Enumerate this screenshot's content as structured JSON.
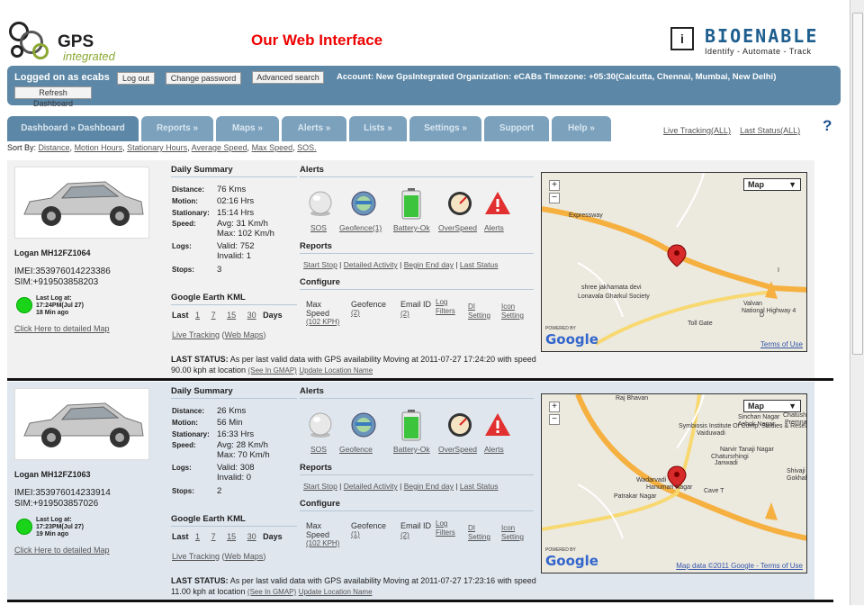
{
  "header": {
    "logo_gps": "GPS",
    "logo_integrated": "integrated",
    "page_heading": "Our Web Interface",
    "brand_name": "BIOENABLE",
    "brand_tagline": "Identify - Automate - Track"
  },
  "userbar": {
    "logged_on": "Logged on as ecabs",
    "logout": "Log out",
    "change_password": "Change password",
    "advanced_search": "Advanced search",
    "refresh": "Refresh Dashboard",
    "account_info": "Account: New GpsIntegrated Organization: eCABs  Timezone: +05:30(Calcutta, Chennai, Mumbai, New Delhi)"
  },
  "tabs": [
    {
      "label": "Dashboard » Dashboard"
    },
    {
      "label": "Reports »"
    },
    {
      "label": "Maps »"
    },
    {
      "label": "Alerts »"
    },
    {
      "label": "Lists »"
    },
    {
      "label": "Settings »"
    },
    {
      "label": "Support"
    },
    {
      "label": "Help »"
    }
  ],
  "right_links": {
    "live_all": "Live Tracking(ALL)",
    "last_all": "Last Status(ALL)",
    "help": "?"
  },
  "sort": {
    "label": "Sort By:",
    "options": [
      "Distance",
      "Motion Hours",
      "Stationary Hours",
      "Average Speed",
      "Max Speed",
      "SOS."
    ]
  },
  "sections": {
    "daily_summary": "Daily Summary",
    "alerts": "Alerts",
    "reports": "Reports",
    "configure": "Configure",
    "kml": "Google Earth KML",
    "kml_last": "Last",
    "kml_days": "Days",
    "kml_options": [
      "1",
      "7",
      "15",
      "30"
    ],
    "live_tracking": "Live Tracking",
    "web_maps": "Web Maps",
    "detail_map": "Click Here to detailed Map",
    "report_links": [
      "Start Stop",
      "Detailed Activity",
      "Begin End day",
      "Last Status"
    ],
    "cfg_maxspeed": "Max Speed",
    "cfg_geofence": "Geofence",
    "cfg_email": "Email ID",
    "cfg_log": "Log Filters",
    "cfg_di": "DI Setting",
    "cfg_icon": "Icon Setting",
    "last_status_label": "LAST STATUS:",
    "see_gmap": "(See In GMAP)",
    "update_loc": "Update Location Name"
  },
  "labels": {
    "distance": "Distance:",
    "motion": "Motion:",
    "stationary": "Stationary:",
    "speed": "Speed:",
    "logs": "Logs:",
    "stops": "Stops:"
  },
  "vehicles": [
    {
      "name": "Logan MH12FZ1064",
      "imei": "IMEI:353976014223386",
      "sim": "SIM:+919503858203",
      "lastlog_head": "Last Log at:",
      "lastlog_time": "17:24PM(Jul 27)",
      "lastlog_ago": "18 Min ago",
      "distance": "76 Kms",
      "motion": "02:16 Hrs",
      "stationary": "15:14 Hrs",
      "speed_avg": "Avg: 31 Km/h",
      "speed_max": "Max: 102 Km/h",
      "logs_valid": "Valid: 752",
      "logs_invalid": "Invalid: 1",
      "stops": "3",
      "alerts": [
        "SOS",
        "Geofence(1)",
        "Battery-Ok",
        "OverSpeed",
        "Alerts"
      ],
      "cfg_maxspeed_val": "(102 KPH)",
      "cfg_geofence_val": "(2)",
      "cfg_email_val": "(2)",
      "last_status": "As per last valid data with GPS availability Moving at 2011-07-27 17:24:20 with speed 90.00 kph at location",
      "map_type": "Map",
      "map_labels": [
        "Expressway",
        "shree jakhamata devi",
        "Lonavala Gharkul Society",
        "Valvan",
        "National Highway 4",
        "Toll Gate",
        "D",
        "I"
      ],
      "map_terms": "Terms of Use"
    },
    {
      "name": "Logan MH12FZ1063",
      "imei": "IMEI:353976014233914",
      "sim": "SIM:+919503857026",
      "lastlog_head": "Last Log at:",
      "lastlog_time": "17:23PM(Jul 27)",
      "lastlog_ago": "19 Min ago",
      "distance": "26 Kms",
      "motion": "56 Min",
      "stationary": "16:33 Hrs",
      "speed_avg": "Avg: 28 Km/h",
      "speed_max": "Max: 70 Km/h",
      "logs_valid": "Valid: 308",
      "logs_invalid": "Invalid: 0",
      "stops": "2",
      "alerts": [
        "SOS",
        "Geofence",
        "Battery-Ok",
        "OverSpeed",
        "Alerts"
      ],
      "cfg_maxspeed_val": "(102 KPH)",
      "cfg_geofence_val": "(1)",
      "cfg_email_val": "(2)",
      "last_status": "As per last valid data with GPS availability Moving at 2011-07-27 17:23:16 with speed 11.00 kph at location",
      "map_type": "Map",
      "map_labels": [
        "Raj Bhavan",
        "Sinchan Nagar",
        "Ashok Nagar",
        "Chatushringi",
        "Premnagar",
        "Symbiosis Institute Of Comp. Studies & Research",
        "Vaiduwadi",
        "Chatursrhingi",
        "Narvir Tanaji Nagar",
        "Janwadi",
        "Shivaji Nagar",
        "Gokhalenagar",
        "Wadarvadi",
        "Hanuman Nagar",
        "Patrakar Nagar",
        "Cave T"
      ],
      "map_terms": "Map data ©2011 Google - Terms of Use"
    }
  ],
  "map_attrib": {
    "powered": "POWERED BY",
    "google": "Google"
  },
  "colors": {
    "bar": "#5c87a6",
    "tab": "#7ba1bd",
    "heading": "#ee0000",
    "brand": "#1d5e8e"
  }
}
